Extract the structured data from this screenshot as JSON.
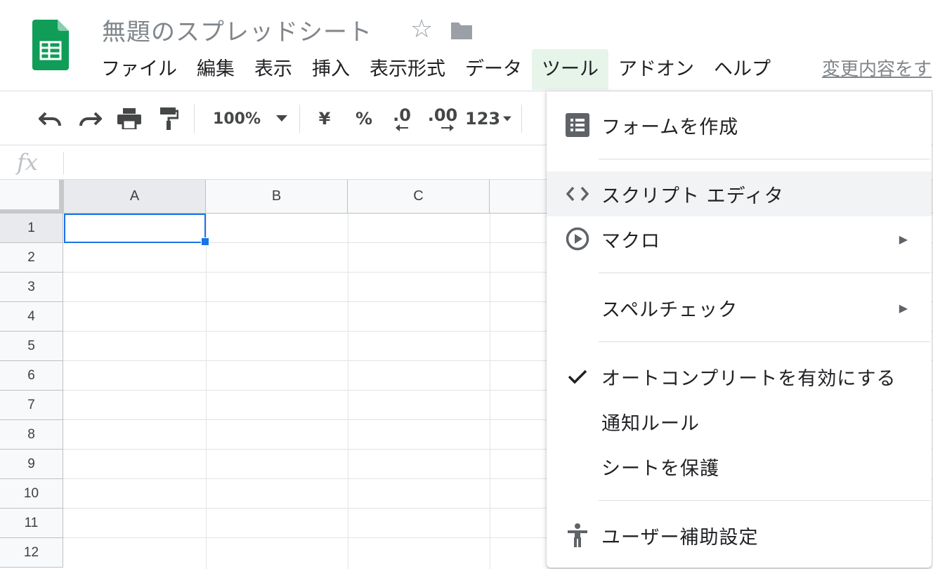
{
  "doc": {
    "title": "無題のスプレッドシート"
  },
  "menu": {
    "file": "ファイル",
    "edit": "編集",
    "view": "表示",
    "insert": "挿入",
    "format": "表示形式",
    "data": "データ",
    "tools": "ツール",
    "addons": "アドオン",
    "help": "ヘルプ",
    "changes": "変更内容をす"
  },
  "toolbar": {
    "zoom": "100%",
    "currency": "¥",
    "percent": "%",
    "dec_decrease": ".0",
    "dec_increase": ".00",
    "more_formats": "123"
  },
  "formula": {
    "fx": "fx"
  },
  "grid": {
    "columns": [
      "A",
      "B",
      "C"
    ],
    "rows": [
      "1",
      "2",
      "3",
      "4",
      "5",
      "6",
      "7",
      "8",
      "9",
      "10",
      "11",
      "12"
    ],
    "selected_cell": "A1"
  },
  "tools_menu": {
    "create_form": "フォームを作成",
    "script_editor": "スクリプト エディタ",
    "macros": "マクロ",
    "spelling": "スペルチェック",
    "autocomplete": "オートコンプリートを有効にする",
    "notifications": "通知ルール",
    "protect_sheet": "シートを保護",
    "accessibility": "ユーザー補助設定"
  },
  "colors": {
    "accent": "#1a73e8",
    "sheets_green": "#0f9d58",
    "menu_active_bg": "#e6f4ea",
    "hover_bg": "#f1f3f4"
  }
}
